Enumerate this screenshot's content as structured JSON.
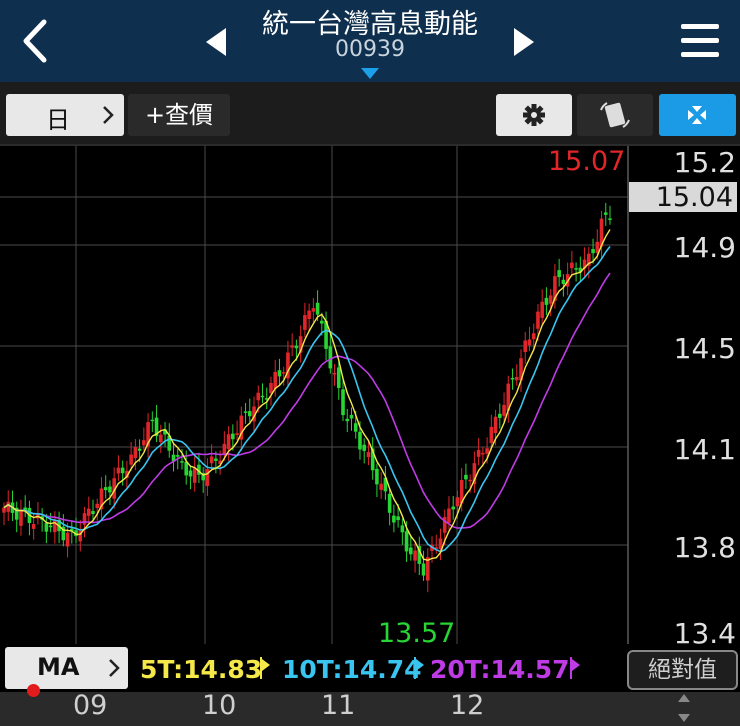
{
  "header": {
    "title": "統一台灣高息動能",
    "code": "00939"
  },
  "toolbar": {
    "period_label": "日",
    "query_label": "+查價"
  },
  "chart_data": {
    "type": "candlestick",
    "y_ticks": [
      "15.2",
      "14.9",
      "14.5",
      "14.1",
      "13.8",
      "13.4"
    ],
    "x_ticks": [
      "09",
      "10",
      "11",
      "12"
    ],
    "current_price": "15.04",
    "high_label": "15.07",
    "low_label": "13.57",
    "colors": {
      "up": "#e0262b",
      "down": "#27d534",
      "ma5": "#f4e84a",
      "ma10": "#39c5f0",
      "ma20": "#bf3be6"
    }
  },
  "ma_bar": {
    "ma_label": "MA",
    "ma5": "5T:14.83",
    "ma10": "10T:14.74",
    "ma20": "20T:14.57",
    "abs_label": "絕對值"
  }
}
